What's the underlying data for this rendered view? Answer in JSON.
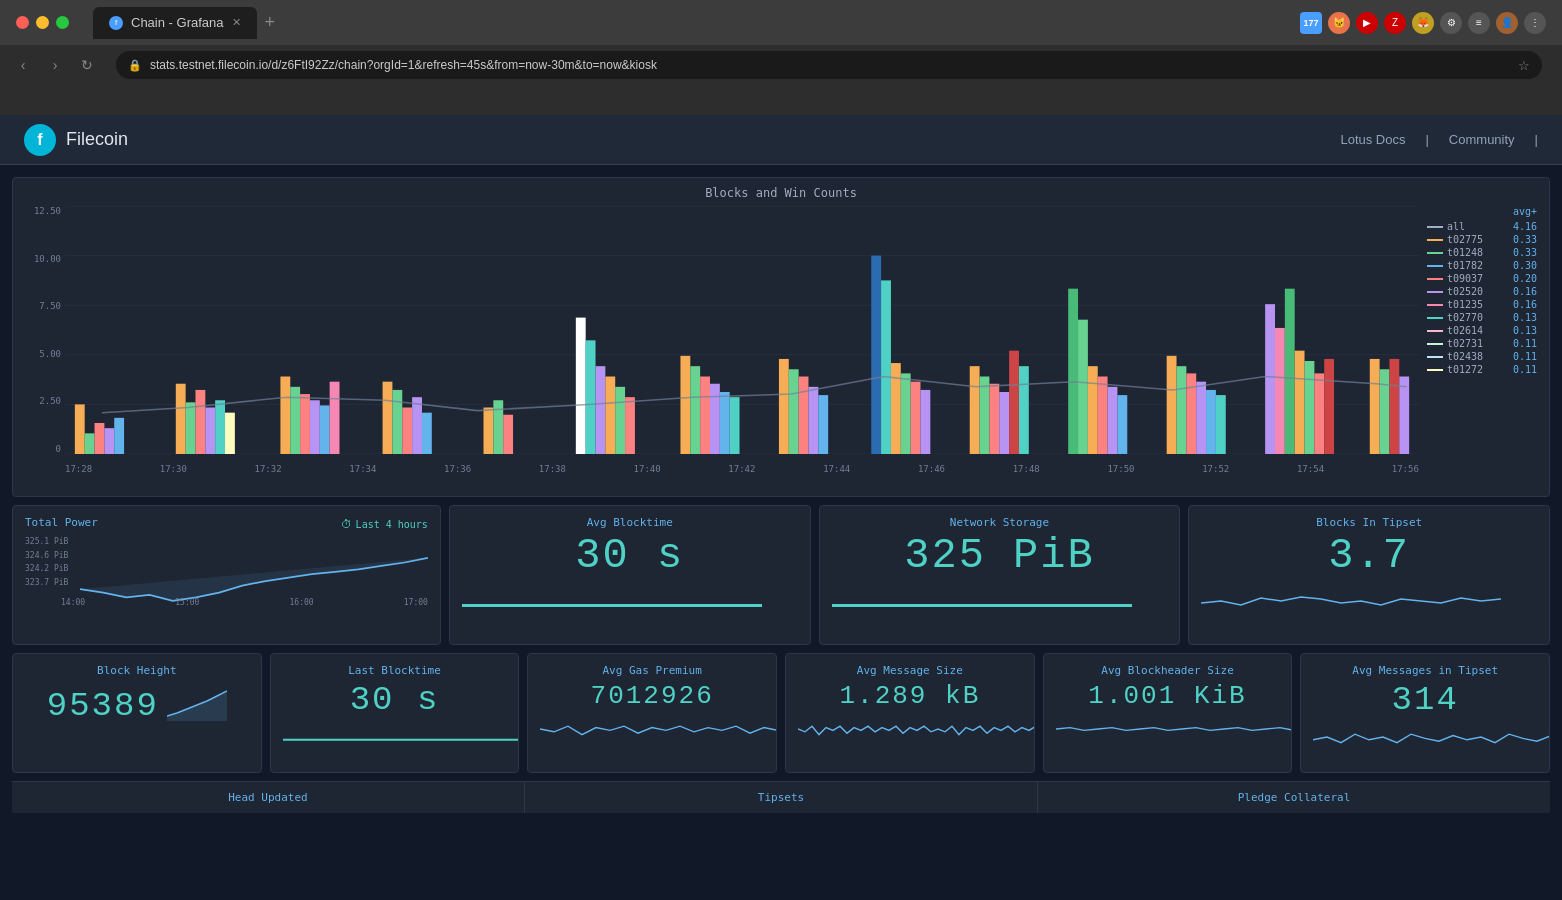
{
  "browser": {
    "tab_title": "Chain - Grafana",
    "address": "stats.testnet.filecoin.io/d/z6FtI92Zz/chain?orgId=1&refresh=45s&from=now-30m&to=now&kiosk",
    "traffic_lights": [
      "red",
      "yellow",
      "green"
    ]
  },
  "header": {
    "logo_letter": "f",
    "brand_name": "Filecoin",
    "nav_items": [
      "Lotus Docs",
      "Community"
    ],
    "divider": "|"
  },
  "chart": {
    "title": "Blocks and Win Counts",
    "y_labels": [
      "12.50",
      "10.00",
      "7.50",
      "5.00",
      "2.50",
      "0"
    ],
    "x_labels": [
      "17:28",
      "17:30",
      "17:32",
      "17:34",
      "17:36",
      "17:38",
      "17:40",
      "17:42",
      "17:44",
      "17:46",
      "17:48",
      "17:50",
      "17:52",
      "17:54",
      "17:56"
    ],
    "legend_header": "avg+",
    "legend_items": [
      {
        "label": "all",
        "value": "4.16",
        "color": "#a0aec0"
      },
      {
        "label": "t02775",
        "value": "0.33",
        "color": "#f6ad55"
      },
      {
        "label": "t01248",
        "value": "0.33",
        "color": "#68d391"
      },
      {
        "label": "t01782",
        "value": "0.30",
        "color": "#63b3ed"
      },
      {
        "label": "t09037",
        "value": "0.20",
        "color": "#fc8181"
      },
      {
        "label": "t02520",
        "value": "0.16",
        "color": "#b794f4"
      },
      {
        "label": "t01235",
        "value": "0.16",
        "color": "#f687b3"
      },
      {
        "label": "t02770",
        "value": "0.13",
        "color": "#4fd1c5"
      },
      {
        "label": "t02614",
        "value": "0.13",
        "color": "#fbb6ce"
      },
      {
        "label": "t02731",
        "value": "0.11",
        "color": "#c6f6d5"
      },
      {
        "label": "t02438",
        "value": "0.11",
        "color": "#bee3f8"
      },
      {
        "label": "t01272",
        "value": "0.11",
        "color": "#fefcbf"
      }
    ]
  },
  "metrics": {
    "total_power": {
      "title": "Total Power",
      "subtitle": "Last 4 hours",
      "y_labels": [
        "325.1 PiB",
        "324.6 PiB",
        "324.2 PiB",
        "323.7 PiB"
      ],
      "x_labels": [
        "14:00",
        "15:00",
        "16:00",
        "17:00"
      ]
    },
    "avg_blocktime": {
      "title": "Avg Blocktime",
      "value": "30 s"
    },
    "network_storage": {
      "title": "Network Storage",
      "value": "325 PiB"
    },
    "blocks_in_tipset": {
      "title": "Blocks In Tipset",
      "value": "3.7"
    }
  },
  "bottom_metrics": {
    "block_height": {
      "title": "Block Height",
      "value": "95389"
    },
    "last_blocktime": {
      "title": "Last Blocktime",
      "value": "30 s"
    },
    "avg_gas_premium": {
      "title": "Avg Gas Premium",
      "value": "7012926"
    },
    "avg_message_size": {
      "title": "Avg Message Size",
      "value": "1.289 kB"
    },
    "avg_blockheader_size": {
      "title": "Avg Blockheader Size",
      "value": "1.001 KiB"
    },
    "avg_messages_tipset": {
      "title": "Avg Messages in Tipset",
      "value": "314"
    }
  },
  "status_bar": {
    "head_updated": "Head Updated",
    "tipsets": "Tipsets",
    "pledge_collateral": "Pledge Collateral"
  }
}
